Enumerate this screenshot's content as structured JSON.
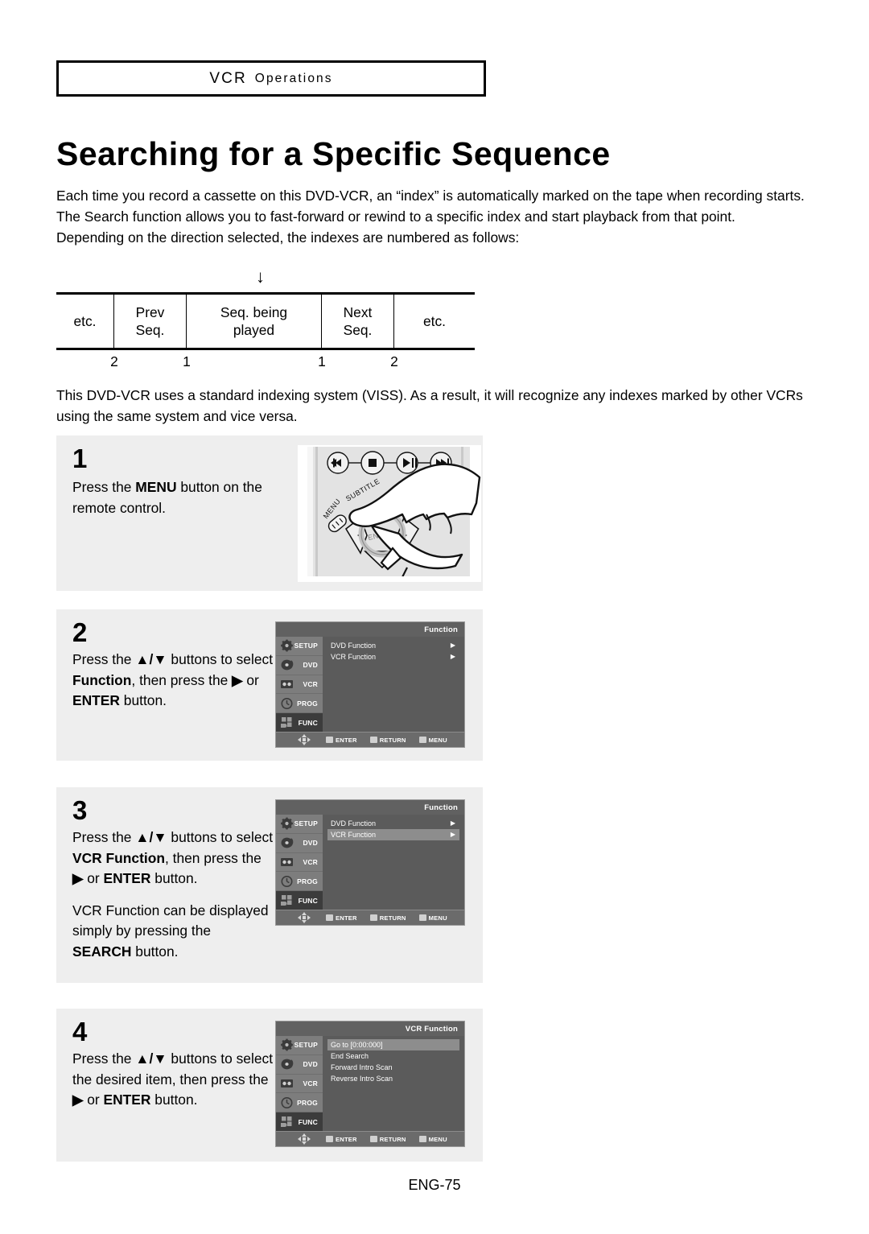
{
  "header": {
    "main": "VCR",
    "smallcaps": "Operations"
  },
  "title": "Searching for a Specific Sequence",
  "intro": {
    "p1": "Each time you record a cassette on this DVD-VCR, an “index” is automatically marked on the tape when recording starts.",
    "p2": "The Search function allows you to fast-forward or rewind to a specific index and start playback from that point. Depending on the direction selected, the indexes are numbered as follows:"
  },
  "sequence_diagram": {
    "arrow": "↓",
    "cells": [
      "etc.",
      "Prev\nSeq.",
      "Seq. being\nplayed",
      "Next\nSeq.",
      "etc."
    ],
    "cell_0": "etc.",
    "cell_1_line1": "Prev",
    "cell_1_line2": "Seq.",
    "cell_2_line1": "Seq. being",
    "cell_2_line2": "played",
    "cell_3_line1": "Next",
    "cell_3_line2": "Seq.",
    "cell_4": "etc.",
    "numbers": [
      "2",
      "1",
      "1",
      "2"
    ],
    "num_0": "2",
    "num_1": "1",
    "num_2": "1",
    "num_3": "2"
  },
  "note": "This DVD-VCR uses a standard indexing system (VISS). As a result, it will recognize any indexes marked by other VCRs using the same system and vice versa.",
  "steps": [
    {
      "number": "1",
      "text_prefix": "Press the ",
      "text_bold": "MENU",
      "text_suffix": " button on the remote control."
    },
    {
      "number": "2",
      "line1_a": "Press the ",
      "line1_arrows": "▲/▼",
      "line1_b": " buttons to select ",
      "line1_bold": "Function",
      "line1_c": ", then press the ",
      "line1_arrow2": "▶",
      "line1_d": " or ",
      "line1_bold2": "ENTER",
      "line1_e": " button."
    },
    {
      "number": "3",
      "line1_a": "Press the ",
      "line1_arrows": "▲/▼",
      "line1_b": " buttons to select ",
      "line1_bold": "VCR Function",
      "line1_c": ", then press the ",
      "line1_arrow2": "▶",
      "line1_d": " or ",
      "line1_bold2": "ENTER",
      "line1_e": " button.",
      "line2_a": "VCR Function can be displayed simply by pressing the ",
      "line2_bold": "SEARCH",
      "line2_b": " button."
    },
    {
      "number": "4",
      "line1_a": "Press the ",
      "line1_arrows": "▲/▼",
      "line1_b": " buttons to select the desired item, then press the ",
      "line1_arrow2": "▶",
      "line1_d": " or ",
      "line1_bold2": "ENTER",
      "line1_e": " button."
    }
  ],
  "remote": {
    "label_menu": "MENU",
    "label_subtitle": "SUBTITLE",
    "label_enter": "ENTER"
  },
  "osd_common": {
    "sidebar": [
      {
        "label": "SETUP",
        "icon": "gear-icon"
      },
      {
        "label": "DVD",
        "icon": "disc-icon"
      },
      {
        "label": "VCR",
        "icon": "cassette-icon"
      },
      {
        "label": "PROG",
        "icon": "clock-icon"
      },
      {
        "label": "FUNC",
        "icon": "blocks-icon"
      }
    ],
    "footer": {
      "enter": "ENTER",
      "return": "RETURN",
      "menu": "MENU"
    },
    "arrow_glyph": "▶"
  },
  "osd_screens": [
    {
      "id": "step2",
      "title": "Function",
      "active_sidebar": "FUNC",
      "rows": [
        {
          "label": "DVD Function",
          "arrow": "▶",
          "highlight": false
        },
        {
          "label": "VCR Function",
          "arrow": "▶",
          "highlight": false
        }
      ]
    },
    {
      "id": "step3",
      "title": "Function",
      "active_sidebar": "FUNC",
      "rows": [
        {
          "label": "DVD Function",
          "arrow": "▶",
          "highlight": false
        },
        {
          "label": "VCR Function",
          "arrow": "▶",
          "highlight": true
        }
      ]
    },
    {
      "id": "step4",
      "title": "VCR Function",
      "active_sidebar": "FUNC",
      "rows": [
        {
          "label": "Go to [0:00:000]",
          "arrow": "",
          "highlight": true
        },
        {
          "label": "End Search",
          "arrow": "",
          "highlight": false
        },
        {
          "label": "Forward Intro Scan",
          "arrow": "",
          "highlight": false
        },
        {
          "label": "Reverse Intro Scan",
          "arrow": "",
          "highlight": false
        }
      ]
    }
  ],
  "footer": {
    "page": "ENG-75"
  },
  "colors": {
    "step_bg": "#eeeeee",
    "osd_bg": "#5b5b5b",
    "osd_sidebar": "#7d7d7d",
    "osd_active": "#3c3c3c",
    "osd_highlight": "#8d8d8d"
  }
}
